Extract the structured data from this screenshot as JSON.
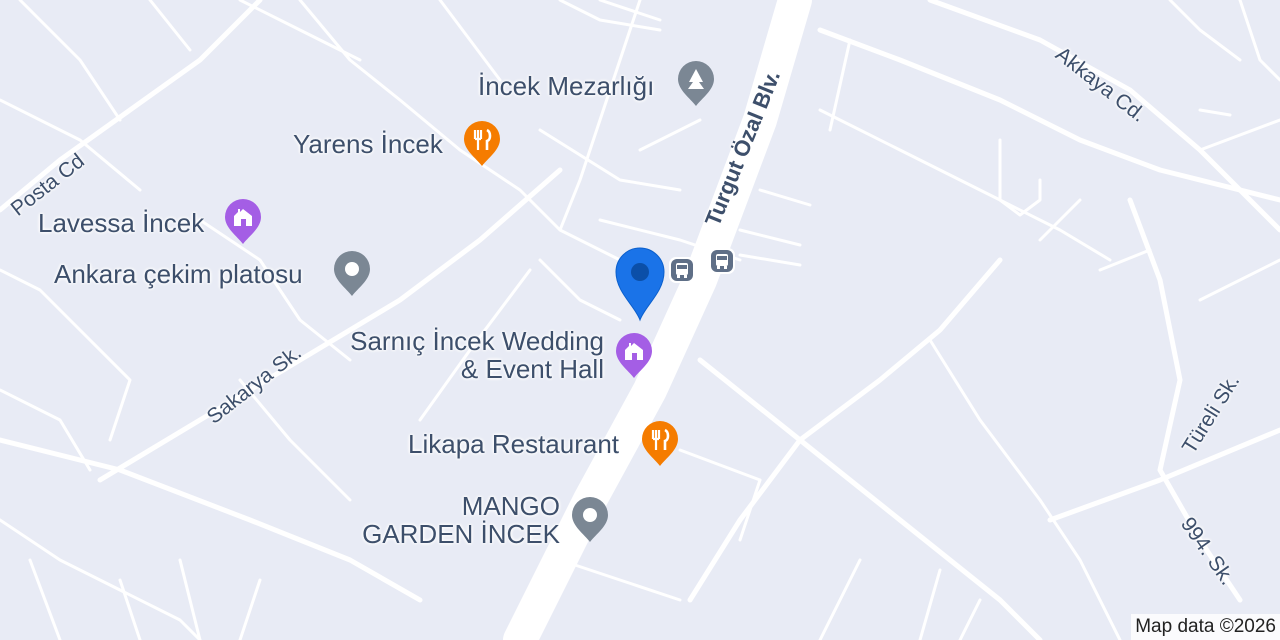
{
  "map": {
    "colors": {
      "background": "#e8ebf5",
      "road": "#ffffff",
      "restaurant": "#f57c00",
      "venue": "#a45ee5",
      "generic": "#7b8794",
      "location": "#1a73e8"
    },
    "places": [
      {
        "id": "incek-mezarligi",
        "name": "İncek Mezarlığı",
        "icon": "cemetery-icon"
      },
      {
        "id": "yarens-incek",
        "name": "Yarens İncek",
        "icon": "restaurant-icon"
      },
      {
        "id": "lavessa-incek",
        "name": "Lavessa İncek",
        "icon": "wedding-venue-icon"
      },
      {
        "id": "ankara-cekim",
        "name": "Ankara çekim platosu",
        "icon": "place-dot-icon"
      },
      {
        "id": "sarnic-incek",
        "name_line1": "Sarnıç İncek Wedding",
        "name_line2": "& Event Hall",
        "icon": "wedding-venue-icon"
      },
      {
        "id": "likapa",
        "name": "Likapa Restaurant",
        "icon": "restaurant-icon"
      },
      {
        "id": "mango",
        "name_line1": "MANGO",
        "name_line2": "GARDEN İNCEK",
        "icon": "place-dot-icon"
      }
    ],
    "roads": {
      "turgut_ozal": "Turgut Özal Blv.",
      "akkaya": "Akkaya Cd.",
      "posta": "Posta Cd",
      "sakarya": "Sakarya Sk.",
      "tureli": "Türeli Sk.",
      "sk994": "994. Sk."
    },
    "attribution": "Map data ©2026"
  }
}
